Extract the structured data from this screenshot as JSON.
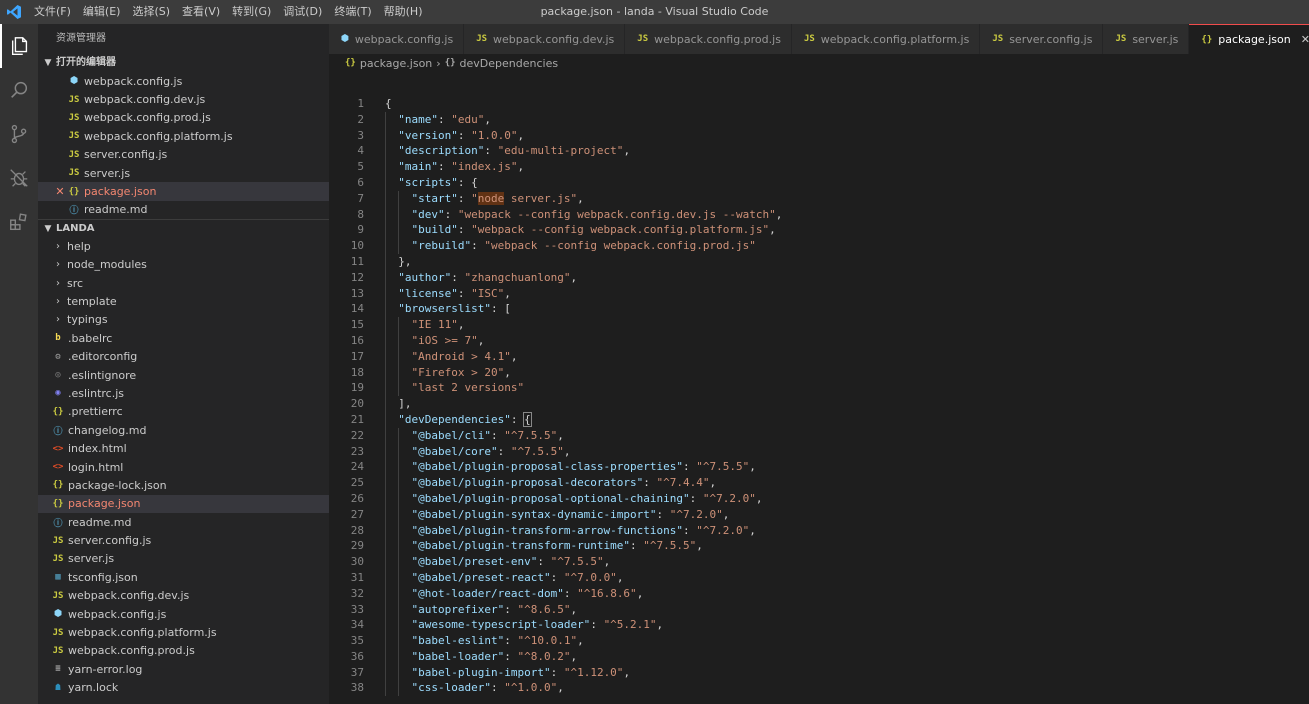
{
  "titlebar": {
    "menu": [
      "文件(F)",
      "编辑(E)",
      "选择(S)",
      "查看(V)",
      "转到(G)",
      "调试(D)",
      "终端(T)",
      "帮助(H)"
    ],
    "title": "package.json - landa - Visual Studio Code"
  },
  "activity": [
    "files-icon",
    "search-icon",
    "source-control-icon",
    "debug-icon",
    "extensions-icon"
  ],
  "sidebar": {
    "title": "资源管理器",
    "open_editors_header": "打开的编辑器",
    "open_editors": [
      {
        "icon": "web",
        "name": "webpack.config.js"
      },
      {
        "icon": "js",
        "name": "webpack.config.dev.js"
      },
      {
        "icon": "js",
        "name": "webpack.config.prod.js"
      },
      {
        "icon": "js",
        "name": "webpack.config.platform.js"
      },
      {
        "icon": "js",
        "name": "server.config.js"
      },
      {
        "icon": "js",
        "name": "server.js"
      },
      {
        "icon": "json",
        "name": "package.json",
        "active": true,
        "close": "✕"
      },
      {
        "icon": "info",
        "name": "readme.md"
      }
    ],
    "project_header": "LANDA",
    "folders": [
      "help",
      "node_modules",
      "src",
      "template",
      "typings"
    ],
    "files": [
      {
        "icon": "babel",
        "name": ".babelrc"
      },
      {
        "icon": "gear",
        "name": ".editorconfig"
      },
      {
        "icon": "esig",
        "name": ".eslintignore"
      },
      {
        "icon": "es",
        "name": ".eslintrc.js"
      },
      {
        "icon": "json",
        "name": ".prettierrc"
      },
      {
        "icon": "md",
        "name": "changelog.md"
      },
      {
        "icon": "html",
        "name": "index.html"
      },
      {
        "icon": "html",
        "name": "login.html"
      },
      {
        "icon": "json",
        "name": "package-lock.json"
      },
      {
        "icon": "json",
        "name": "package.json",
        "active": true
      },
      {
        "icon": "info",
        "name": "readme.md"
      },
      {
        "icon": "js",
        "name": "server.config.js"
      },
      {
        "icon": "js",
        "name": "server.js"
      },
      {
        "icon": "ts",
        "name": "tsconfig.json"
      },
      {
        "icon": "js",
        "name": "webpack.config.dev.js"
      },
      {
        "icon": "web",
        "name": "webpack.config.js"
      },
      {
        "icon": "js",
        "name": "webpack.config.platform.js"
      },
      {
        "icon": "js",
        "name": "webpack.config.prod.js"
      },
      {
        "icon": "log",
        "name": "yarn-error.log"
      },
      {
        "icon": "yarn",
        "name": "yarn.lock"
      }
    ]
  },
  "tabs": [
    {
      "icon": "web",
      "name": "webpack.config.js"
    },
    {
      "icon": "js",
      "name": "webpack.config.dev.js"
    },
    {
      "icon": "js",
      "name": "webpack.config.prod.js"
    },
    {
      "icon": "js",
      "name": "webpack.config.platform.js"
    },
    {
      "icon": "js",
      "name": "server.config.js"
    },
    {
      "icon": "js",
      "name": "server.js"
    },
    {
      "icon": "json",
      "name": "package.json",
      "active": true,
      "close": "✕"
    },
    {
      "icon": "info",
      "name": ""
    }
  ],
  "breadcrumb": [
    "package.json",
    "devDependencies"
  ],
  "code": [
    [
      [
        "p",
        "{"
      ]
    ],
    [
      [
        "k",
        "\"name\""
      ],
      [
        "p",
        ": "
      ],
      [
        "s",
        "\"edu\""
      ],
      [
        "p",
        ","
      ]
    ],
    [
      [
        "k",
        "\"version\""
      ],
      [
        "p",
        ": "
      ],
      [
        "s",
        "\"1.0.0\""
      ],
      [
        "p",
        ","
      ]
    ],
    [
      [
        "k",
        "\"description\""
      ],
      [
        "p",
        ": "
      ],
      [
        "s",
        "\"edu-multi-project\""
      ],
      [
        "p",
        ","
      ]
    ],
    [
      [
        "k",
        "\"main\""
      ],
      [
        "p",
        ": "
      ],
      [
        "s",
        "\"index.js\""
      ],
      [
        "p",
        ","
      ]
    ],
    [
      [
        "k",
        "\"scripts\""
      ],
      [
        "p",
        ": {"
      ]
    ],
    [
      [
        "k",
        "\"start\""
      ],
      [
        "p",
        ": "
      ],
      [
        "s",
        "\""
      ],
      [
        "s hl",
        "node"
      ],
      [
        "s",
        " server.js\""
      ],
      [
        "p",
        ","
      ]
    ],
    [
      [
        "k",
        "\"dev\""
      ],
      [
        "p",
        ": "
      ],
      [
        "s",
        "\"webpack --config webpack.config.dev.js --watch\""
      ],
      [
        "p",
        ","
      ]
    ],
    [
      [
        "k",
        "\"build\""
      ],
      [
        "p",
        ": "
      ],
      [
        "s",
        "\"webpack --config webpack.config.platform.js\""
      ],
      [
        "p",
        ","
      ]
    ],
    [
      [
        "k",
        "\"rebuild\""
      ],
      [
        "p",
        ": "
      ],
      [
        "s",
        "\"webpack --config webpack.config.prod.js\""
      ]
    ],
    [
      [
        "p",
        "},"
      ]
    ],
    [
      [
        "k",
        "\"author\""
      ],
      [
        "p",
        ": "
      ],
      [
        "s",
        "\"zhangchuanlong\""
      ],
      [
        "p",
        ","
      ]
    ],
    [
      [
        "k",
        "\"license\""
      ],
      [
        "p",
        ": "
      ],
      [
        "s",
        "\"ISC\""
      ],
      [
        "p",
        ","
      ]
    ],
    [
      [
        "k",
        "\"browserslist\""
      ],
      [
        "p",
        ": ["
      ]
    ],
    [
      [
        "s",
        "\"IE 11\""
      ],
      [
        "p",
        ","
      ]
    ],
    [
      [
        "s",
        "\"iOS >= 7\""
      ],
      [
        "p",
        ","
      ]
    ],
    [
      [
        "s",
        "\"Android > 4.1\""
      ],
      [
        "p",
        ","
      ]
    ],
    [
      [
        "s",
        "\"Firefox > 20\""
      ],
      [
        "p",
        ","
      ]
    ],
    [
      [
        "s",
        "\"last 2 versions\""
      ]
    ],
    [
      [
        "p",
        "],"
      ]
    ],
    [
      [
        "k",
        "\"devDependencies\""
      ],
      [
        "p",
        ": "
      ],
      [
        "p bm",
        "{"
      ]
    ],
    [
      [
        "k",
        "\"@babel/cli\""
      ],
      [
        "p",
        ": "
      ],
      [
        "s",
        "\"^7.5.5\""
      ],
      [
        "p",
        ","
      ]
    ],
    [
      [
        "k",
        "\"@babel/core\""
      ],
      [
        "p",
        ": "
      ],
      [
        "s",
        "\"^7.5.5\""
      ],
      [
        "p",
        ","
      ]
    ],
    [
      [
        "k",
        "\"@babel/plugin-proposal-class-properties\""
      ],
      [
        "p",
        ": "
      ],
      [
        "s",
        "\"^7.5.5\""
      ],
      [
        "p",
        ","
      ]
    ],
    [
      [
        "k",
        "\"@babel/plugin-proposal-decorators\""
      ],
      [
        "p",
        ": "
      ],
      [
        "s",
        "\"^7.4.4\""
      ],
      [
        "p",
        ","
      ]
    ],
    [
      [
        "k",
        "\"@babel/plugin-proposal-optional-chaining\""
      ],
      [
        "p",
        ": "
      ],
      [
        "s",
        "\"^7.2.0\""
      ],
      [
        "p",
        ","
      ]
    ],
    [
      [
        "k",
        "\"@babel/plugin-syntax-dynamic-import\""
      ],
      [
        "p",
        ": "
      ],
      [
        "s",
        "\"^7.2.0\""
      ],
      [
        "p",
        ","
      ]
    ],
    [
      [
        "k",
        "\"@babel/plugin-transform-arrow-functions\""
      ],
      [
        "p",
        ": "
      ],
      [
        "s",
        "\"^7.2.0\""
      ],
      [
        "p",
        ","
      ]
    ],
    [
      [
        "k",
        "\"@babel/plugin-transform-runtime\""
      ],
      [
        "p",
        ": "
      ],
      [
        "s",
        "\"^7.5.5\""
      ],
      [
        "p",
        ","
      ]
    ],
    [
      [
        "k",
        "\"@babel/preset-env\""
      ],
      [
        "p",
        ": "
      ],
      [
        "s",
        "\"^7.5.5\""
      ],
      [
        "p",
        ","
      ]
    ],
    [
      [
        "k",
        "\"@babel/preset-react\""
      ],
      [
        "p",
        ": "
      ],
      [
        "s",
        "\"^7.0.0\""
      ],
      [
        "p",
        ","
      ]
    ],
    [
      [
        "k",
        "\"@hot-loader/react-dom\""
      ],
      [
        "p",
        ": "
      ],
      [
        "s",
        "\"^16.8.6\""
      ],
      [
        "p",
        ","
      ]
    ],
    [
      [
        "k",
        "\"autoprefixer\""
      ],
      [
        "p",
        ": "
      ],
      [
        "s",
        "\"^8.6.5\""
      ],
      [
        "p",
        ","
      ]
    ],
    [
      [
        "k",
        "\"awesome-typescript-loader\""
      ],
      [
        "p",
        ": "
      ],
      [
        "s",
        "\"^5.2.1\""
      ],
      [
        "p",
        ","
      ]
    ],
    [
      [
        "k",
        "\"babel-eslint\""
      ],
      [
        "p",
        ": "
      ],
      [
        "s",
        "\"^10.0.1\""
      ],
      [
        "p",
        ","
      ]
    ],
    [
      [
        "k",
        "\"babel-loader\""
      ],
      [
        "p",
        ": "
      ],
      [
        "s",
        "\"^8.0.2\""
      ],
      [
        "p",
        ","
      ]
    ],
    [
      [
        "k",
        "\"babel-plugin-import\""
      ],
      [
        "p",
        ": "
      ],
      [
        "s",
        "\"^1.12.0\""
      ],
      [
        "p",
        ","
      ]
    ],
    [
      [
        "k",
        "\"css-loader\""
      ],
      [
        "p",
        ": "
      ],
      [
        "s",
        "\"^1.0.0\""
      ],
      [
        "p",
        ","
      ]
    ]
  ],
  "indent": [
    0,
    1,
    1,
    1,
    1,
    1,
    2,
    2,
    2,
    2,
    1,
    1,
    1,
    1,
    2,
    2,
    2,
    2,
    2,
    1,
    1,
    2,
    2,
    2,
    2,
    2,
    2,
    2,
    2,
    2,
    2,
    2,
    2,
    2,
    2,
    2,
    2,
    2
  ]
}
